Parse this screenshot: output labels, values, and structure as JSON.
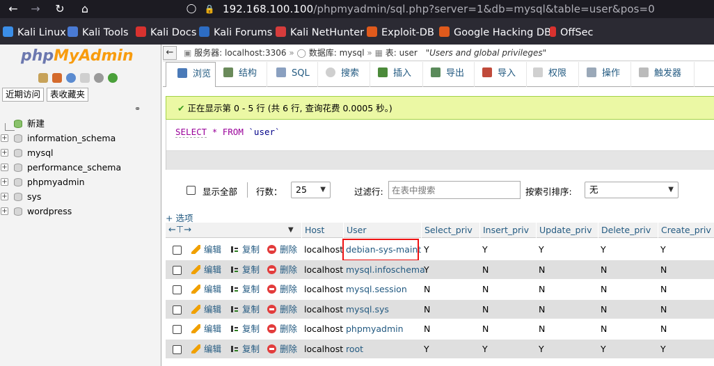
{
  "browser": {
    "url_host": "192.168.100.100",
    "url_path": "/phpmyadmin/sql.php?server=1&db=mysql&table=user&pos=0",
    "bookmarks": [
      "Kali Linux",
      "Kali Tools",
      "Kali Docs",
      "Kali Forums",
      "Kali NetHunter",
      "Exploit-DB",
      "Google Hacking DB",
      "OffSec"
    ]
  },
  "left": {
    "logo_a": "php",
    "logo_b": "MyAdmin",
    "btn_recent": "近期访问",
    "btn_favorites": "表收藏夹",
    "tree": [
      "新建",
      "information_schema",
      "mysql",
      "performance_schema",
      "phpmyadmin",
      "sys",
      "wordpress"
    ]
  },
  "breadcrumb": {
    "server": "服务器: localhost:3306",
    "db": "数据库: mysql",
    "table": "表: user",
    "comment": "\"Users and global privileges\""
  },
  "tabs": [
    "浏览",
    "结构",
    "SQL",
    "搜索",
    "插入",
    "导出",
    "导入",
    "权限",
    "操作",
    "触发器"
  ],
  "message": "正在显示第 0 - 5 行 (共 6 行, 查询花费 0.0005 秒。)",
  "sql": {
    "select": "SELECT",
    "star": "*",
    "from": "FROM",
    "table": "`user`"
  },
  "controls": {
    "show_all": "显示全部",
    "rows_label": "行数：",
    "rows_value": "25",
    "filter_label": "过滤行:",
    "filter_placeholder": "在表中搜索",
    "sort_label": "按索引排序:",
    "sort_value": "无"
  },
  "options_link": "+ 选项",
  "table": {
    "columns": [
      "Host",
      "User",
      "Select_priv",
      "Insert_priv",
      "Update_priv",
      "Delete_priv",
      "Create_priv"
    ],
    "action_edit": "编辑",
    "action_copy": "复制",
    "action_delete": "删除",
    "rows": [
      [
        "localhost",
        "debian-sys-maint",
        "Y",
        "Y",
        "Y",
        "Y",
        "Y"
      ],
      [
        "localhost",
        "mysql.infoschema",
        "Y",
        "N",
        "N",
        "N",
        "N"
      ],
      [
        "localhost",
        "mysql.session",
        "N",
        "N",
        "N",
        "N",
        "N"
      ],
      [
        "localhost",
        "mysql.sys",
        "N",
        "N",
        "N",
        "N",
        "N"
      ],
      [
        "localhost",
        "phpmyadmin",
        "N",
        "N",
        "N",
        "N",
        "N"
      ],
      [
        "localhost",
        "root",
        "Y",
        "Y",
        "Y",
        "Y",
        "Y"
      ]
    ]
  }
}
